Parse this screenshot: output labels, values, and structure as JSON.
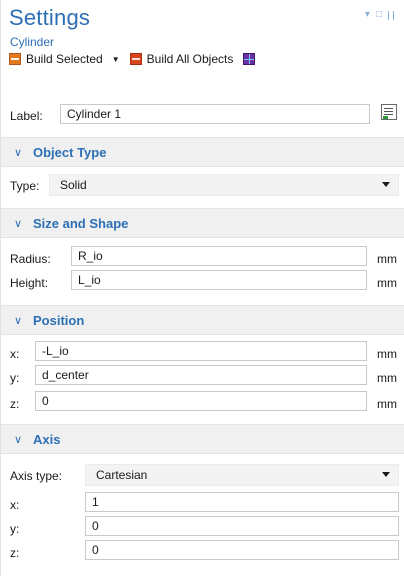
{
  "header": {
    "title": "Settings",
    "subtitle": "Cylinder"
  },
  "toolbar": {
    "build_selected": "Build Selected",
    "build_all": "Build All Objects"
  },
  "label": {
    "label": "Label:",
    "value": "Cylinder 1"
  },
  "sections": {
    "object_type": "Object Type",
    "size_shape": "Size and Shape",
    "position": "Position",
    "axis": "Axis"
  },
  "object_type": {
    "label": "Type:",
    "value": "Solid"
  },
  "size_shape": {
    "radius": {
      "label": "Radius:",
      "value": "R_io",
      "unit": "mm"
    },
    "height": {
      "label": "Height:",
      "value": "L_io",
      "unit": "mm"
    }
  },
  "position": {
    "x": {
      "label": "x:",
      "value": "-L_io",
      "unit": "mm"
    },
    "y": {
      "label": "y:",
      "value": "d_center",
      "unit": "mm"
    },
    "z": {
      "label": "z:",
      "value": "0",
      "unit": "mm"
    }
  },
  "axis": {
    "type_label": "Axis type:",
    "type_value": "Cartesian",
    "x": {
      "label": "x:",
      "value": "1"
    },
    "y": {
      "label": "y:",
      "value": "0"
    },
    "z": {
      "label": "z:",
      "value": "0"
    }
  },
  "colors": {
    "accent": "#2d6fb5",
    "section_bg": "#f0f0f0"
  },
  "icons": [
    "build-selected-icon",
    "build-all-icon",
    "geometry-grid-icon",
    "label-edit-icon",
    "chevron-down-icon"
  ]
}
